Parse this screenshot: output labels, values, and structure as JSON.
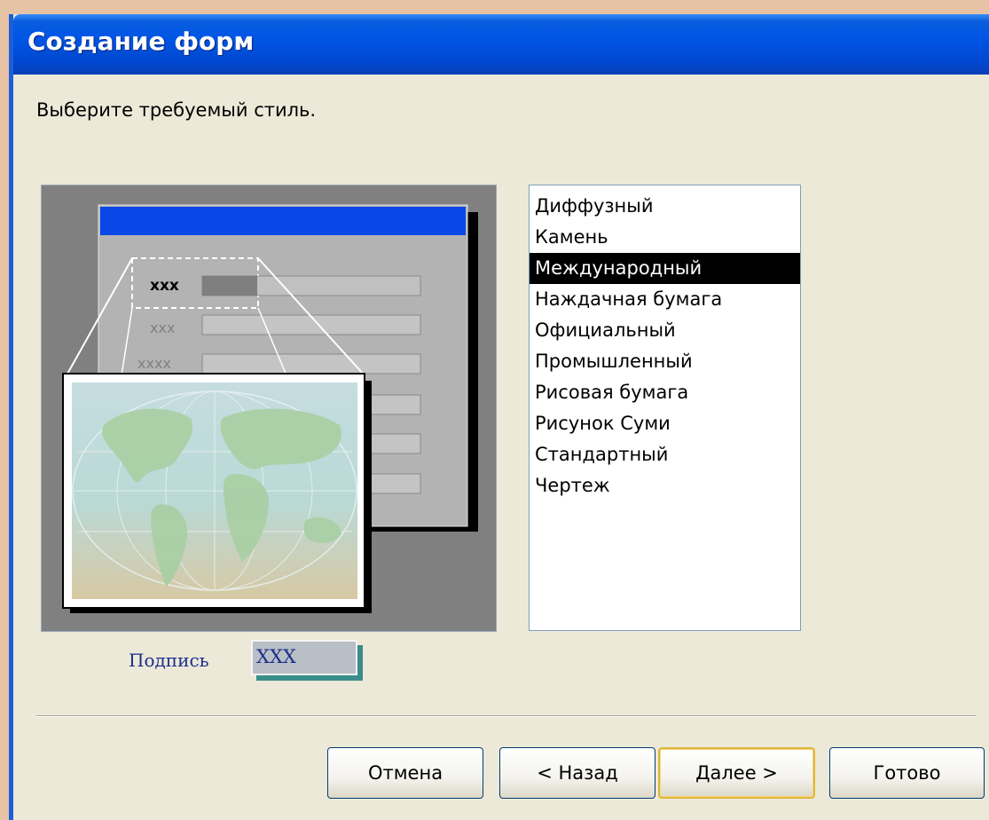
{
  "window": {
    "title": "Создание форм",
    "prompt": "Выберите требуемый стиль."
  },
  "preview": {
    "field_labels": [
      "xxx",
      "xxx",
      "xxxx"
    ],
    "caption": "Подпись",
    "sample_value": "XXX"
  },
  "styles": {
    "items": [
      "Диффузный",
      "Камень",
      "Международный",
      "Наждачная бумага",
      "Официальный",
      "Промышленный",
      "Рисовая бумага",
      "Рисунок Суми",
      "Стандартный",
      "Чертеж"
    ],
    "selected": "Международный"
  },
  "buttons": {
    "cancel": "Отмена",
    "back": "< Назад",
    "next": "Далее >",
    "finish": "Готово"
  },
  "colors": {
    "titlebar": "#0055e5",
    "dialog": "#ece9d8",
    "selection": "#000000"
  }
}
